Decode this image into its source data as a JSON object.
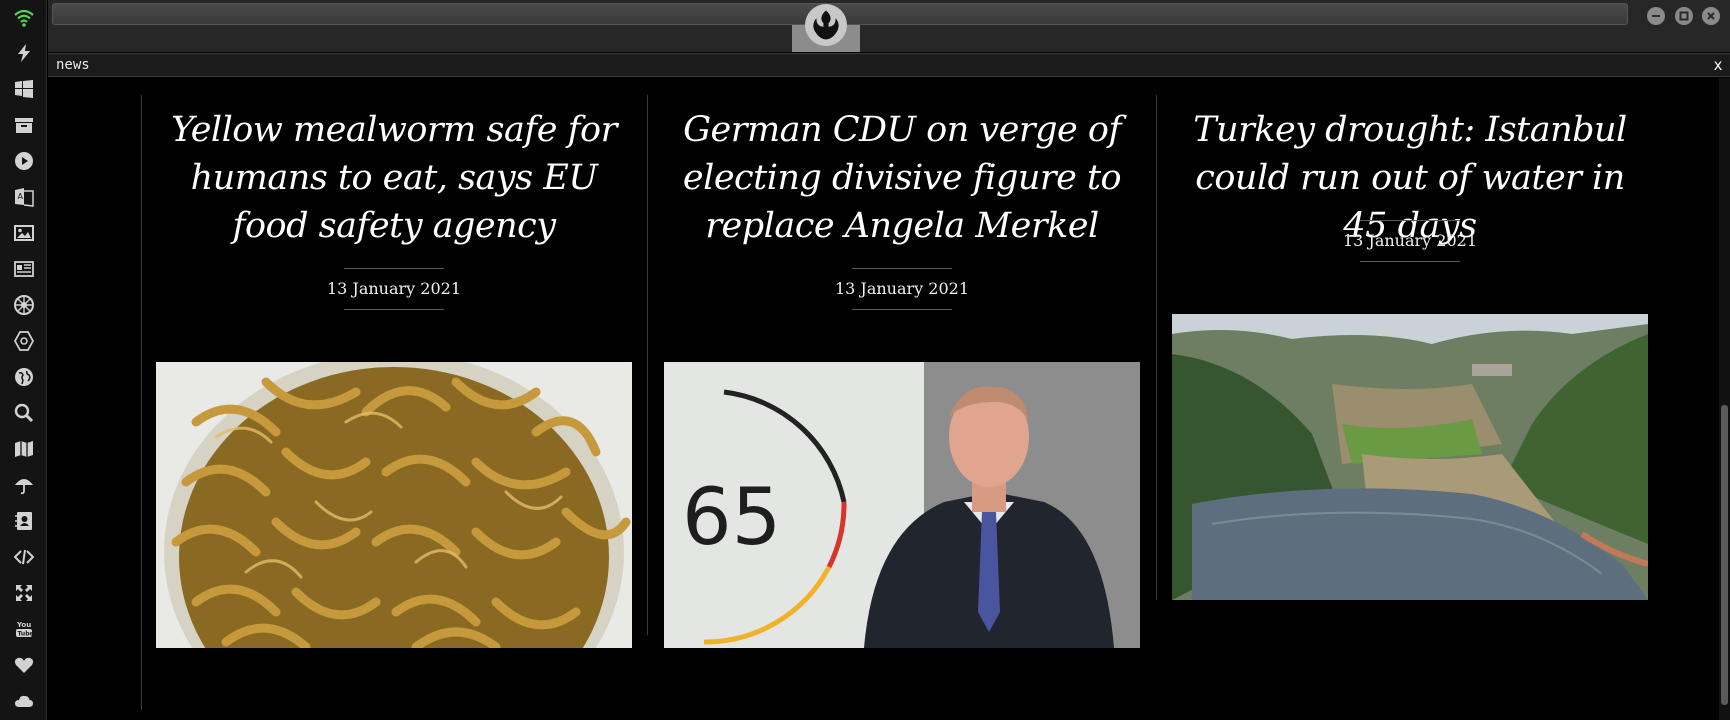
{
  "window": {
    "title": "",
    "tab_title": "news",
    "tab_close": "x",
    "controls": {
      "minimize": "minimize-icon",
      "maximize": "maximize-icon",
      "close": "close-icon"
    },
    "logo": "rebel-alliance-logo"
  },
  "dock": {
    "items": [
      {
        "icon": "wifi-icon",
        "color": "#58d15a"
      },
      {
        "icon": "lightning-icon"
      },
      {
        "icon": "windows-icon"
      },
      {
        "icon": "archive-icon"
      },
      {
        "icon": "play-icon"
      },
      {
        "icon": "translate-icon"
      },
      {
        "icon": "image-icon"
      },
      {
        "icon": "newspaper-icon"
      },
      {
        "icon": "rebel-icon"
      },
      {
        "icon": "empire-icon"
      },
      {
        "icon": "globe-icon"
      },
      {
        "icon": "search-icon"
      },
      {
        "icon": "map-icon"
      },
      {
        "icon": "umbrella-icon"
      },
      {
        "icon": "contacts-icon"
      },
      {
        "icon": "code-icon"
      },
      {
        "icon": "expand-icon"
      },
      {
        "icon": "youtube-icon"
      },
      {
        "icon": "heart-icon"
      },
      {
        "icon": "cloud-icon"
      }
    ]
  },
  "articles": [
    {
      "headline": "Yellow mealworm safe for humans to eat, says EU food safety agency",
      "date": "13 January 2021",
      "image": "mealworms-photo"
    },
    {
      "headline": "German CDU on verge of electing divisive figure to replace Angela Merkel",
      "date": "13 January 2021",
      "image": "politician-photo",
      "image_text": "65"
    },
    {
      "headline": "Turkey drought: Istanbul could run out of water in 45 days",
      "date": "13 January 2021",
      "image": "reservoir-photo"
    }
  ],
  "colors": {
    "background": "#000000",
    "chrome": "#272727",
    "dock": "#141414",
    "accent_wifi": "#58d15a"
  }
}
